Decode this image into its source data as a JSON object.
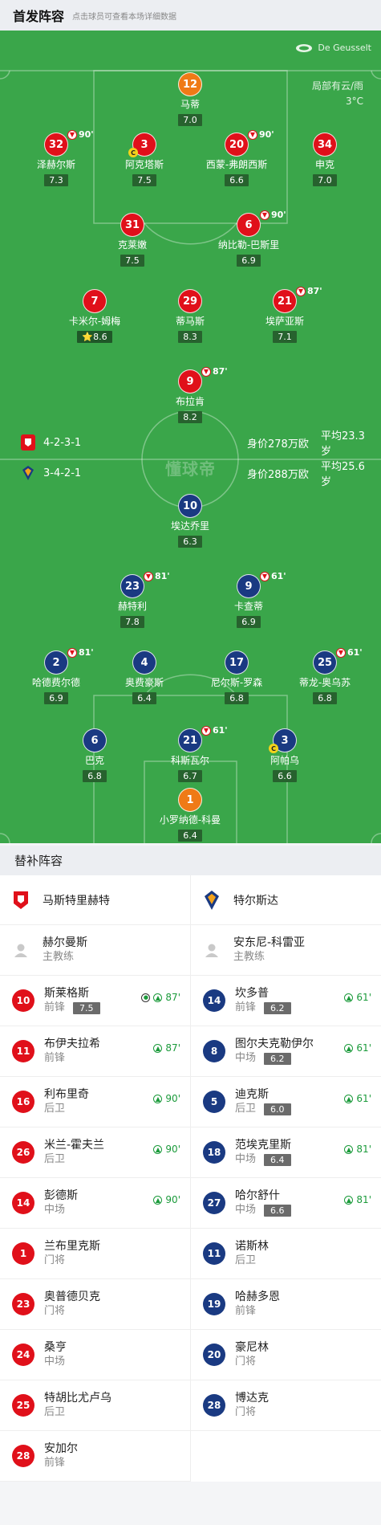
{
  "header": {
    "title": "首发阵容",
    "subtitle": "点击球员可查看本场详细数据"
  },
  "pitch": {
    "stadium": "De Geusselt",
    "weather": [
      "局部有云/雨",
      "3°C"
    ],
    "watermark": "懂球帝"
  },
  "teams": {
    "home": {
      "name": "马斯特里赫特",
      "formation": "4-2-3-1",
      "value": "身价278万欧",
      "age": "平均23.3岁",
      "color": "#e0101a"
    },
    "away": {
      "name": "特尔斯达",
      "formation": "3-4-2-1",
      "value": "身价288万欧",
      "age": "平均25.6岁",
      "color": "#1a3a82"
    }
  },
  "home_players": [
    {
      "num": "12",
      "name": "马蒂",
      "rating": "7.0",
      "gk": true
    },
    {
      "num": "32",
      "name": "泽赫尔斯",
      "rating": "7.3",
      "sub": "90'"
    },
    {
      "num": "3",
      "name": "阿克塔斯",
      "rating": "7.5",
      "captain": true
    },
    {
      "num": "20",
      "name": "西蒙-弗朗西斯",
      "rating": "6.6",
      "sub": "90'"
    },
    {
      "num": "34",
      "name": "申克",
      "rating": "7.0"
    },
    {
      "num": "31",
      "name": "克莱嫩",
      "rating": "7.5"
    },
    {
      "num": "6",
      "name": "纳比勒-巴斯里",
      "rating": "6.9",
      "sub": "90'"
    },
    {
      "num": "7",
      "name": "卡米尔-姆梅",
      "rating": "8.6",
      "star": true
    },
    {
      "num": "29",
      "name": "蒂马斯",
      "rating": "8.3"
    },
    {
      "num": "21",
      "name": "埃萨亚斯",
      "rating": "7.1",
      "sub": "87'"
    },
    {
      "num": "9",
      "name": "布拉肯",
      "rating": "8.2",
      "sub": "87'"
    }
  ],
  "away_players": [
    {
      "num": "10",
      "name": "埃达乔里",
      "rating": "6.3"
    },
    {
      "num": "23",
      "name": "赫特利",
      "rating": "7.8",
      "sub": "81'"
    },
    {
      "num": "9",
      "name": "卡查蒂",
      "rating": "6.9",
      "sub": "61'"
    },
    {
      "num": "2",
      "name": "哈德费尔德",
      "rating": "6.9",
      "sub": "81'"
    },
    {
      "num": "4",
      "name": "奥费豪斯",
      "rating": "6.4"
    },
    {
      "num": "17",
      "name": "尼尔斯-罗森",
      "rating": "6.8"
    },
    {
      "num": "25",
      "name": "蒂龙-奥乌苏",
      "rating": "6.8",
      "sub": "61'"
    },
    {
      "num": "6",
      "name": "巴克",
      "rating": "6.8"
    },
    {
      "num": "21",
      "name": "科斯瓦尔",
      "rating": "6.7",
      "sub": "61'"
    },
    {
      "num": "3",
      "name": "阿帕乌",
      "rating": "6.6",
      "captain": true
    },
    {
      "num": "1",
      "name": "小罗纳德-科曼",
      "rating": "6.4",
      "gk": true
    }
  ],
  "subs": {
    "title": "替补阵容",
    "home": {
      "coach": {
        "name": "赫尔曼斯",
        "role": "主教练"
      },
      "players": [
        {
          "num": "10",
          "name": "斯莱格斯",
          "pos": "前锋",
          "rating": "7.5",
          "min": "87'",
          "goal": true
        },
        {
          "num": "11",
          "name": "布伊夫拉希",
          "pos": "前锋",
          "min": "87'"
        },
        {
          "num": "16",
          "name": "利布里奇",
          "pos": "后卫",
          "min": "90'"
        },
        {
          "num": "26",
          "name": "米兰-霍夫兰",
          "pos": "后卫",
          "min": "90'"
        },
        {
          "num": "14",
          "name": "彭德斯",
          "pos": "中场",
          "min": "90'"
        },
        {
          "num": "1",
          "name": "兰布里克斯",
          "pos": "门将"
        },
        {
          "num": "23",
          "name": "奥普德贝克",
          "pos": "门将"
        },
        {
          "num": "24",
          "name": "桑亨",
          "pos": "中场"
        },
        {
          "num": "25",
          "name": "特胡比尤卢乌",
          "pos": "后卫"
        },
        {
          "num": "28",
          "name": "安加尔",
          "pos": "前锋"
        }
      ]
    },
    "away": {
      "coach": {
        "name": "安东尼-科雷亚",
        "role": "主教练"
      },
      "players": [
        {
          "num": "14",
          "name": "坎多普",
          "pos": "前锋",
          "rating": "6.2",
          "min": "61'"
        },
        {
          "num": "8",
          "name": "图尔夫克勒伊尔",
          "pos": "中场",
          "rating": "6.2",
          "min": "61'"
        },
        {
          "num": "5",
          "name": "迪克斯",
          "pos": "后卫",
          "rating": "6.0",
          "min": "61'"
        },
        {
          "num": "18",
          "name": "范埃克里斯",
          "pos": "中场",
          "rating": "6.4",
          "min": "81'"
        },
        {
          "num": "27",
          "name": "哈尔舒什",
          "pos": "中场",
          "rating": "6.6",
          "min": "81'"
        },
        {
          "num": "11",
          "name": "诺斯林",
          "pos": "后卫"
        },
        {
          "num": "19",
          "name": "哈赫多恩",
          "pos": "前锋"
        },
        {
          "num": "20",
          "name": "豪尼林",
          "pos": "门将"
        },
        {
          "num": "28",
          "name": "博达克",
          "pos": "门将"
        }
      ]
    }
  }
}
